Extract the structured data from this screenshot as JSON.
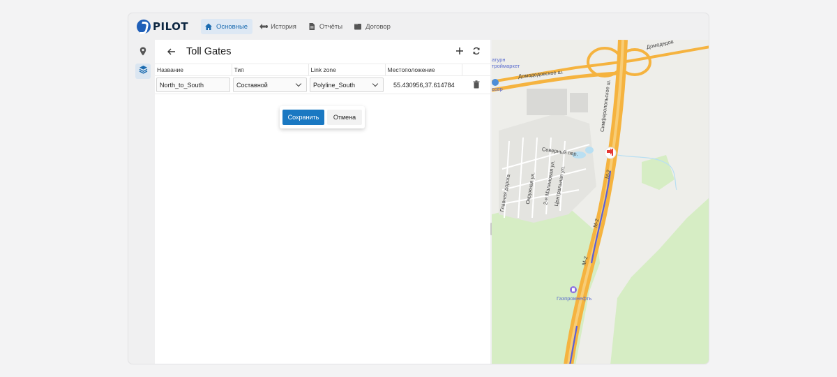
{
  "app": {
    "logo_text": "PILOT"
  },
  "nav": [
    {
      "label": "Основные",
      "icon": "home-icon",
      "active": true
    },
    {
      "label": "История",
      "icon": "history-icon",
      "active": false
    },
    {
      "label": "Отчёты",
      "icon": "report-icon",
      "active": false
    },
    {
      "label": "Договор",
      "icon": "contract-icon",
      "active": false
    }
  ],
  "rail": [
    {
      "icon": "location-pin-icon",
      "active": false
    },
    {
      "icon": "layers-icon",
      "active": true
    }
  ],
  "panel": {
    "title": "Toll Gates",
    "columns": [
      "Название",
      "Тип",
      "Link zone",
      "Местоположение"
    ],
    "row": {
      "name": "North_to_South",
      "type": "Составной",
      "link_zone": "Polyline_South",
      "location": "55.430956,37.614784"
    },
    "save_label": "Сохранить",
    "cancel_label": "Отмена"
  },
  "map": {
    "labels": {
      "store1": "атурн",
      "store2": "троймаркет",
      "road_domodedovo": "Домодедовское ш.",
      "domodedovo_top": "Домодедов",
      "road_simferopol": "Симферопольское ш.",
      "severny": "Северный пер.",
      "glavnaya": "Главная дорога",
      "okruzhnaya": "Окружная ул.",
      "malinovaya": "2-я Малиновая ул.",
      "tsentralnaya": "Центральная ул.",
      "m2_a": "М-2",
      "m2_b": "М-2",
      "m2_c": "М-2",
      "gazprom": "Газпромнефть",
      "fragment": "ссер"
    },
    "colors": {
      "highway": "#f5b33f",
      "route": "#5b5fd6",
      "forest": "#d6edc4",
      "toll_gate": "#e53935"
    }
  }
}
